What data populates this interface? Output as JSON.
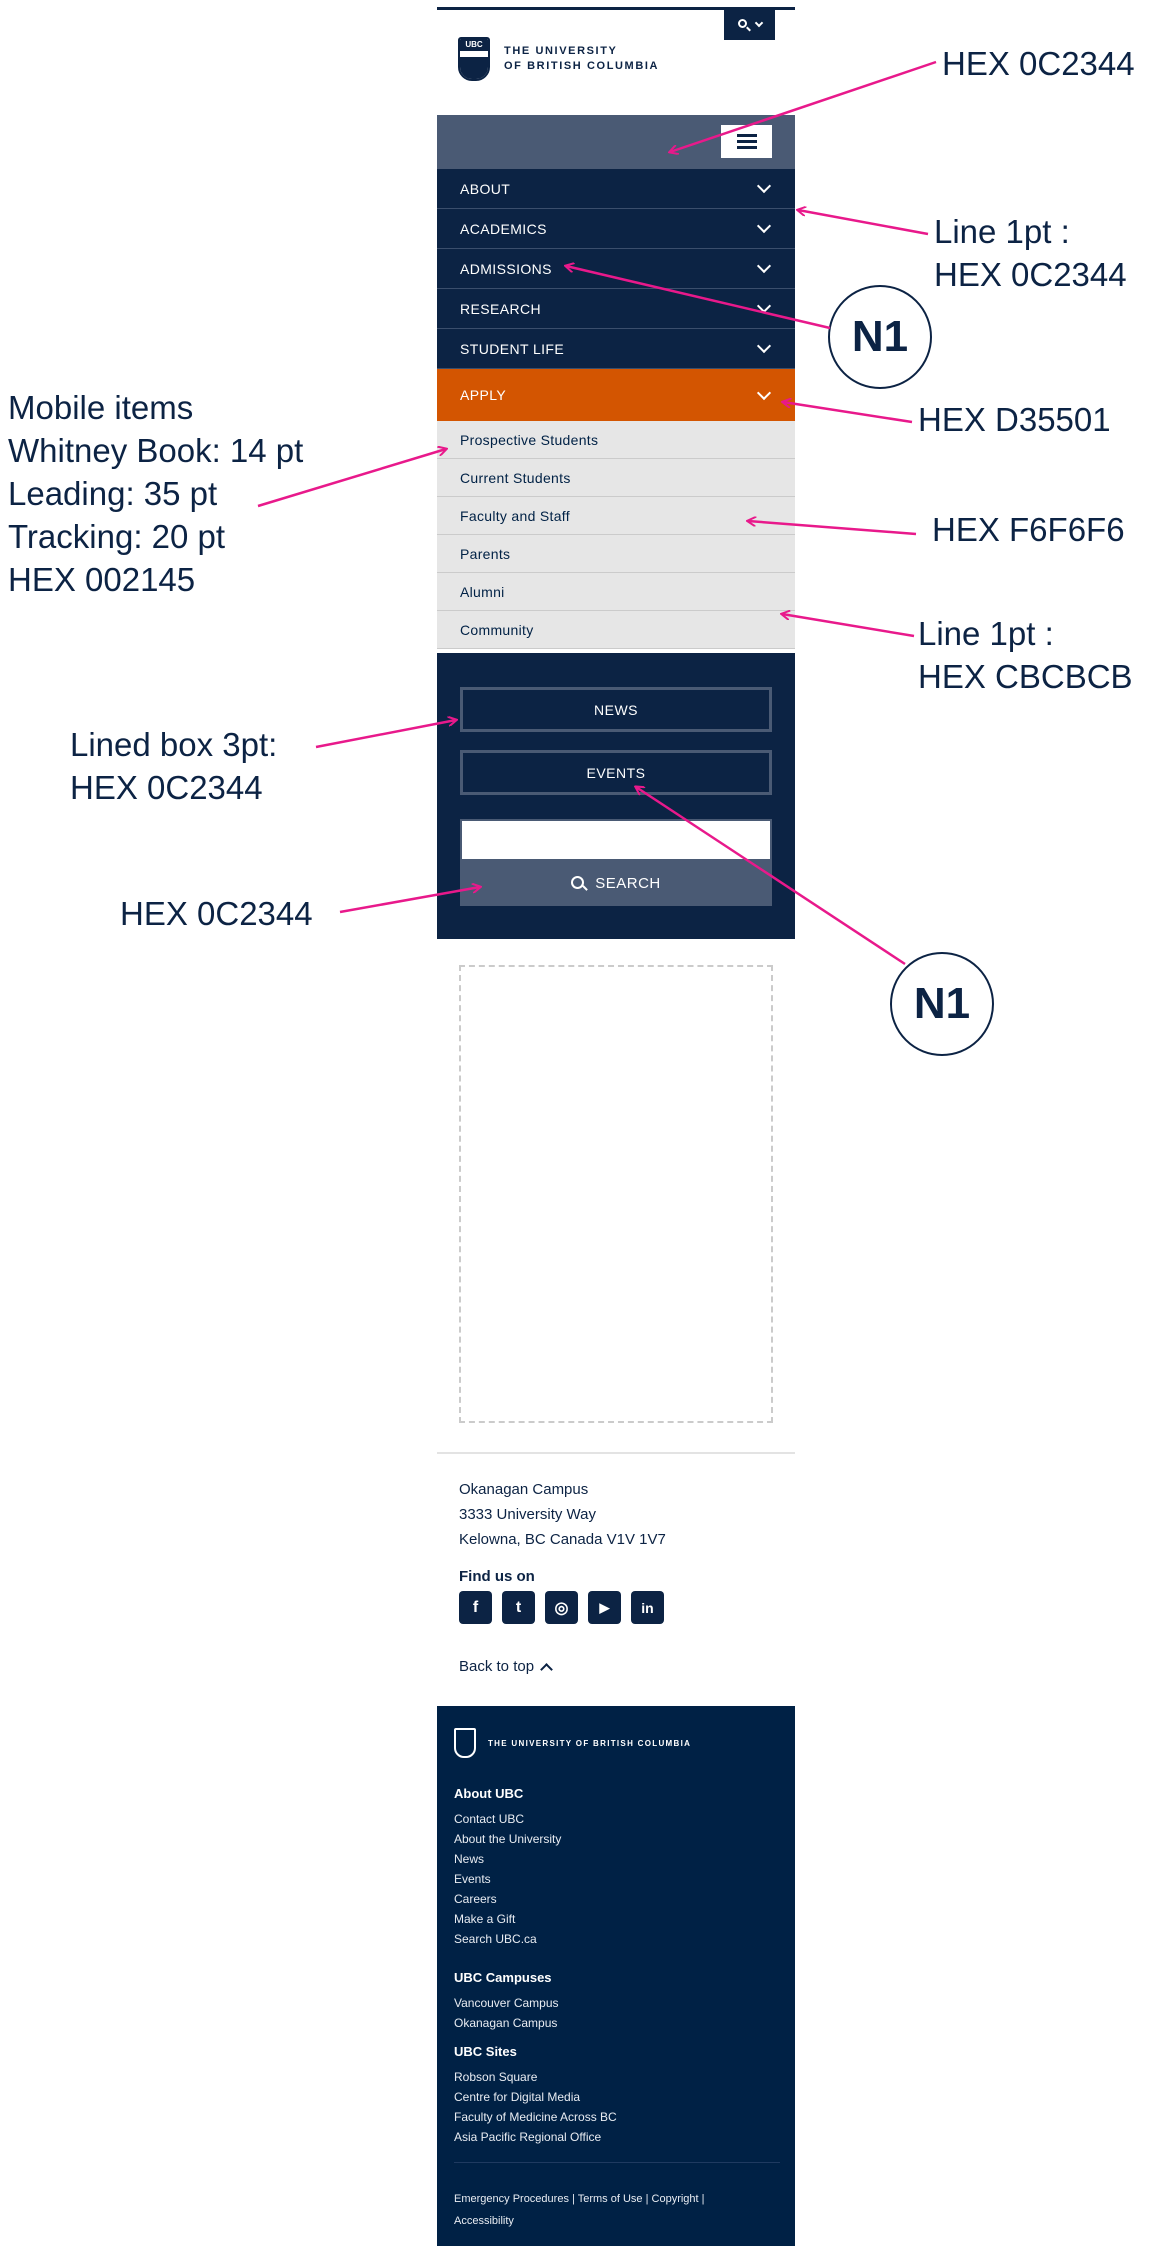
{
  "brand": {
    "crest_text": "UBC",
    "wordmark_line1": "THE UNIVERSITY",
    "wordmark_line2": "OF BRITISH COLUMBIA"
  },
  "nav": {
    "items": [
      {
        "label": "ABOUT"
      },
      {
        "label": "ACADEMICS"
      },
      {
        "label": "ADMISSIONS"
      },
      {
        "label": "RESEARCH"
      },
      {
        "label": "STUDENT LIFE"
      },
      {
        "label": "APPLY"
      }
    ],
    "submenu": [
      {
        "label": "Prospective Students"
      },
      {
        "label": "Current Students"
      },
      {
        "label": "Faculty and Staff"
      },
      {
        "label": "Parents"
      },
      {
        "label": "Alumni"
      },
      {
        "label": "Community"
      }
    ],
    "news_label": "NEWS",
    "events_label": "EVENTS",
    "search_label": "SEARCH"
  },
  "contact": {
    "line1": "Okanagan Campus",
    "line2": "3333 University Way",
    "line3": "Kelowna, BC Canada V1V 1V7",
    "find_us": "Find us on",
    "socials": [
      {
        "icon": "facebook-icon",
        "glyph": "f"
      },
      {
        "icon": "twitter-icon",
        "glyph": "t"
      },
      {
        "icon": "instagram-icon",
        "glyph": "◎"
      },
      {
        "icon": "youtube-icon",
        "glyph": "▶"
      },
      {
        "icon": "linkedin-icon",
        "glyph": "in"
      }
    ],
    "back_to_top": "Back to top"
  },
  "footer": {
    "wordmark": "THE UNIVERSITY OF BRITISH COLUMBIA",
    "about_heading": "About UBC",
    "about_links": [
      "Contact UBC",
      "About the University",
      "News",
      "Events",
      "Careers",
      "Make a Gift",
      "Search UBC.ca"
    ],
    "campuses_heading": "UBC Campuses",
    "campuses_links": [
      "Vancouver Campus",
      "Okanagan Campus"
    ],
    "sites_heading": "UBC Sites",
    "sites_links": [
      "Robson Square",
      "Centre for Digital Media",
      "Faculty of Medicine Across BC",
      "Asia Pacific Regional Office"
    ],
    "legal": [
      "Emergency Procedures",
      "Terms of Use",
      "Copyright",
      "Accessibility"
    ],
    "legal_separator": "|"
  },
  "annotations": {
    "hex_navy_top": "HEX 0C2344",
    "line_navy_1": "Line 1pt :",
    "line_navy_2": "HEX 0C2344",
    "n1_upper": "N1",
    "hex_apply": "HEX D35501",
    "hex_sub": "HEX F6F6F6",
    "line_grey_1": "Line 1pt :",
    "line_grey_2": "HEX CBCBCB",
    "mobile_1": "Mobile items",
    "mobile_2": "Whitney Book: 14 pt",
    "mobile_3": "Leading: 35 pt",
    "mobile_4": "Tracking: 20 pt",
    "mobile_5": "HEX 002145",
    "lined_1": "Lined box 3pt:",
    "lined_2": "HEX 0C2344",
    "hex_search": "HEX 0C2344",
    "n1_lower": "N1"
  },
  "colors": {
    "navy": "#0C2344",
    "apply_orange": "#D35501",
    "submenu_bg": "#F6F6F6",
    "line_grey": "#CBCBCB",
    "text_dark": "#002145",
    "annotation_arrow": "#E8198B"
  }
}
